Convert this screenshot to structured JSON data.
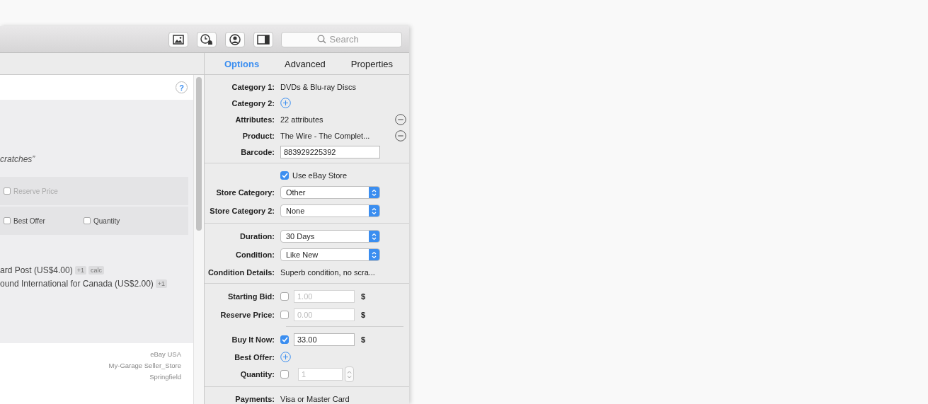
{
  "toolbar": {
    "search": {
      "placeholder": "Search"
    }
  },
  "left_panel": {
    "help_label": "?",
    "description_fragment": "cratches”",
    "option_bands": [
      {
        "options": [
          {
            "label": "Reserve Price",
            "checked": false,
            "disabled": true
          }
        ]
      },
      {
        "options": [
          {
            "label": "Best Offer",
            "checked": false,
            "disabled": false
          },
          {
            "label": "Quantity",
            "checked": false,
            "disabled": false
          }
        ]
      }
    ],
    "shipping": [
      {
        "text": "ard Post (US$4.00)",
        "badges": [
          "+1",
          "calc"
        ]
      },
      {
        "text": "ound International for Canada (US$2.00)",
        "badges": [
          "+1"
        ]
      }
    ],
    "seller": [
      "eBay USA",
      "My-Garage Seller_Store",
      "Springfield"
    ]
  },
  "tabs": [
    {
      "label": "Options",
      "selected": true
    },
    {
      "label": "Advanced",
      "selected": false
    },
    {
      "label": "Properties",
      "selected": false
    }
  ],
  "sections": [
    {
      "inset_divider": false,
      "rows": [
        {
          "kind": "text",
          "label": "Category 1:",
          "value": "DVDs & Blu-ray Discs"
        },
        {
          "kind": "add",
          "label": "Category 2:"
        },
        {
          "kind": "remove",
          "label": "Attributes:",
          "value": "22 attributes"
        },
        {
          "kind": "remove",
          "label": "Product:",
          "value": "The Wire - The Complet..."
        },
        {
          "kind": "input",
          "label": "Barcode:",
          "value": "883929225392"
        }
      ]
    },
    {
      "inset_divider": false,
      "rows": [
        {
          "kind": "checkbox",
          "text": "Use eBay Store",
          "checked": true
        },
        {
          "kind": "select",
          "label": "Store Category:",
          "value": "Other"
        },
        {
          "kind": "select",
          "label": "Store Category 2:",
          "value": "None"
        }
      ]
    },
    {
      "inset_divider": false,
      "rows": [
        {
          "kind": "select",
          "label": "Duration:",
          "value": "30 Days"
        },
        {
          "kind": "select",
          "label": "Condition:",
          "value": "Like New"
        },
        {
          "kind": "text",
          "label": "Condition Details:",
          "value": "Superb condition, no scra..."
        }
      ]
    },
    {
      "inset_divider": true,
      "rows": [
        {
          "kind": "price",
          "label": "Starting Bid:",
          "checked": false,
          "value": "1.00",
          "currency": "$"
        },
        {
          "kind": "price",
          "label": "Reserve Price:",
          "checked": false,
          "value": "0.00",
          "currency": "$"
        }
      ]
    },
    {
      "inset_divider": false,
      "rows": [
        {
          "kind": "price",
          "label": "Buy It Now:",
          "checked": true,
          "value": "33.00",
          "currency": "$"
        },
        {
          "kind": "add",
          "label": "Best Offer:"
        },
        {
          "kind": "stepper",
          "label": "Quantity:",
          "checked": false,
          "value": "1"
        }
      ]
    },
    {
      "inset_divider": false,
      "rows": [
        {
          "kind": "text",
          "label": "Payments:",
          "value": "Visa or Master Card"
        }
      ]
    }
  ]
}
